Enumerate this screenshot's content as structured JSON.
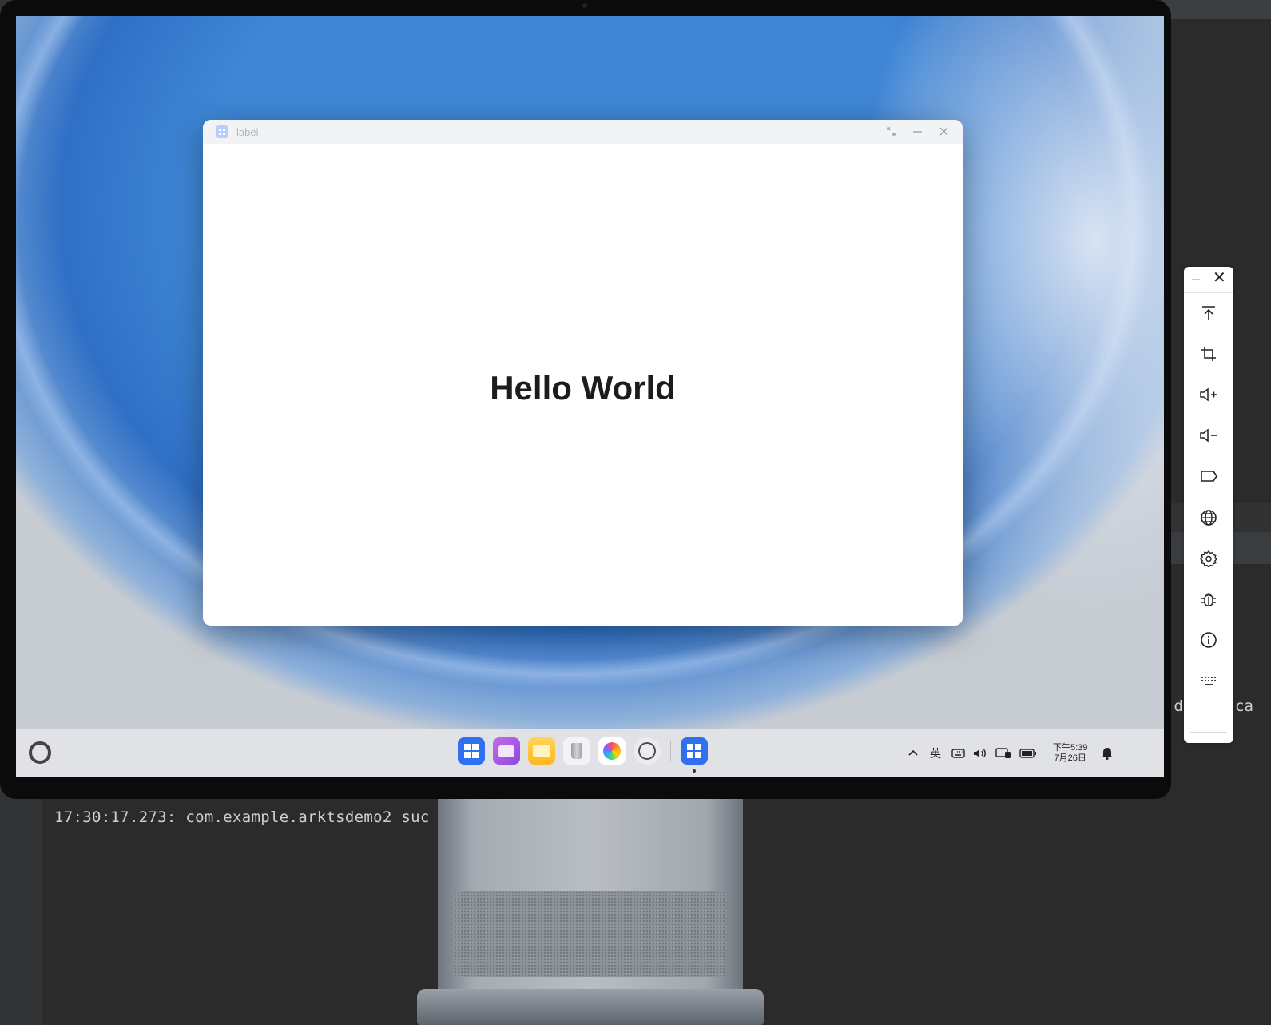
{
  "console": {
    "log_line": "17:30:17.273: com.example.arktsdemo2 suc",
    "fragment_left": "'da",
    "fragment_right": "ca"
  },
  "app_window": {
    "title": "label",
    "content_text": "Hello World",
    "controls": [
      "restore-icon",
      "minimize-icon",
      "close-icon"
    ]
  },
  "taskbar": {
    "dock_apps": [
      "app-launcher",
      "multi-window",
      "files",
      "trash",
      "photos",
      "settings",
      "running-app"
    ],
    "tray": {
      "chevron": "^",
      "ime": "英",
      "keyboard_icon": "keyboard-icon",
      "volume_icon": "volume-icon",
      "display_icon": "display-icon",
      "battery_icon": "battery-icon"
    },
    "clock_time": "下午5:39",
    "clock_date": "7月26日"
  },
  "emulator_toolbar": {
    "minimize": "–",
    "close": "✕",
    "buttons": [
      "upload-icon",
      "crop-icon",
      "volume-up-icon",
      "volume-down-icon",
      "power-icon",
      "globe-icon",
      "gear-icon",
      "bug-icon",
      "info-icon",
      "keyboard-icon"
    ]
  }
}
